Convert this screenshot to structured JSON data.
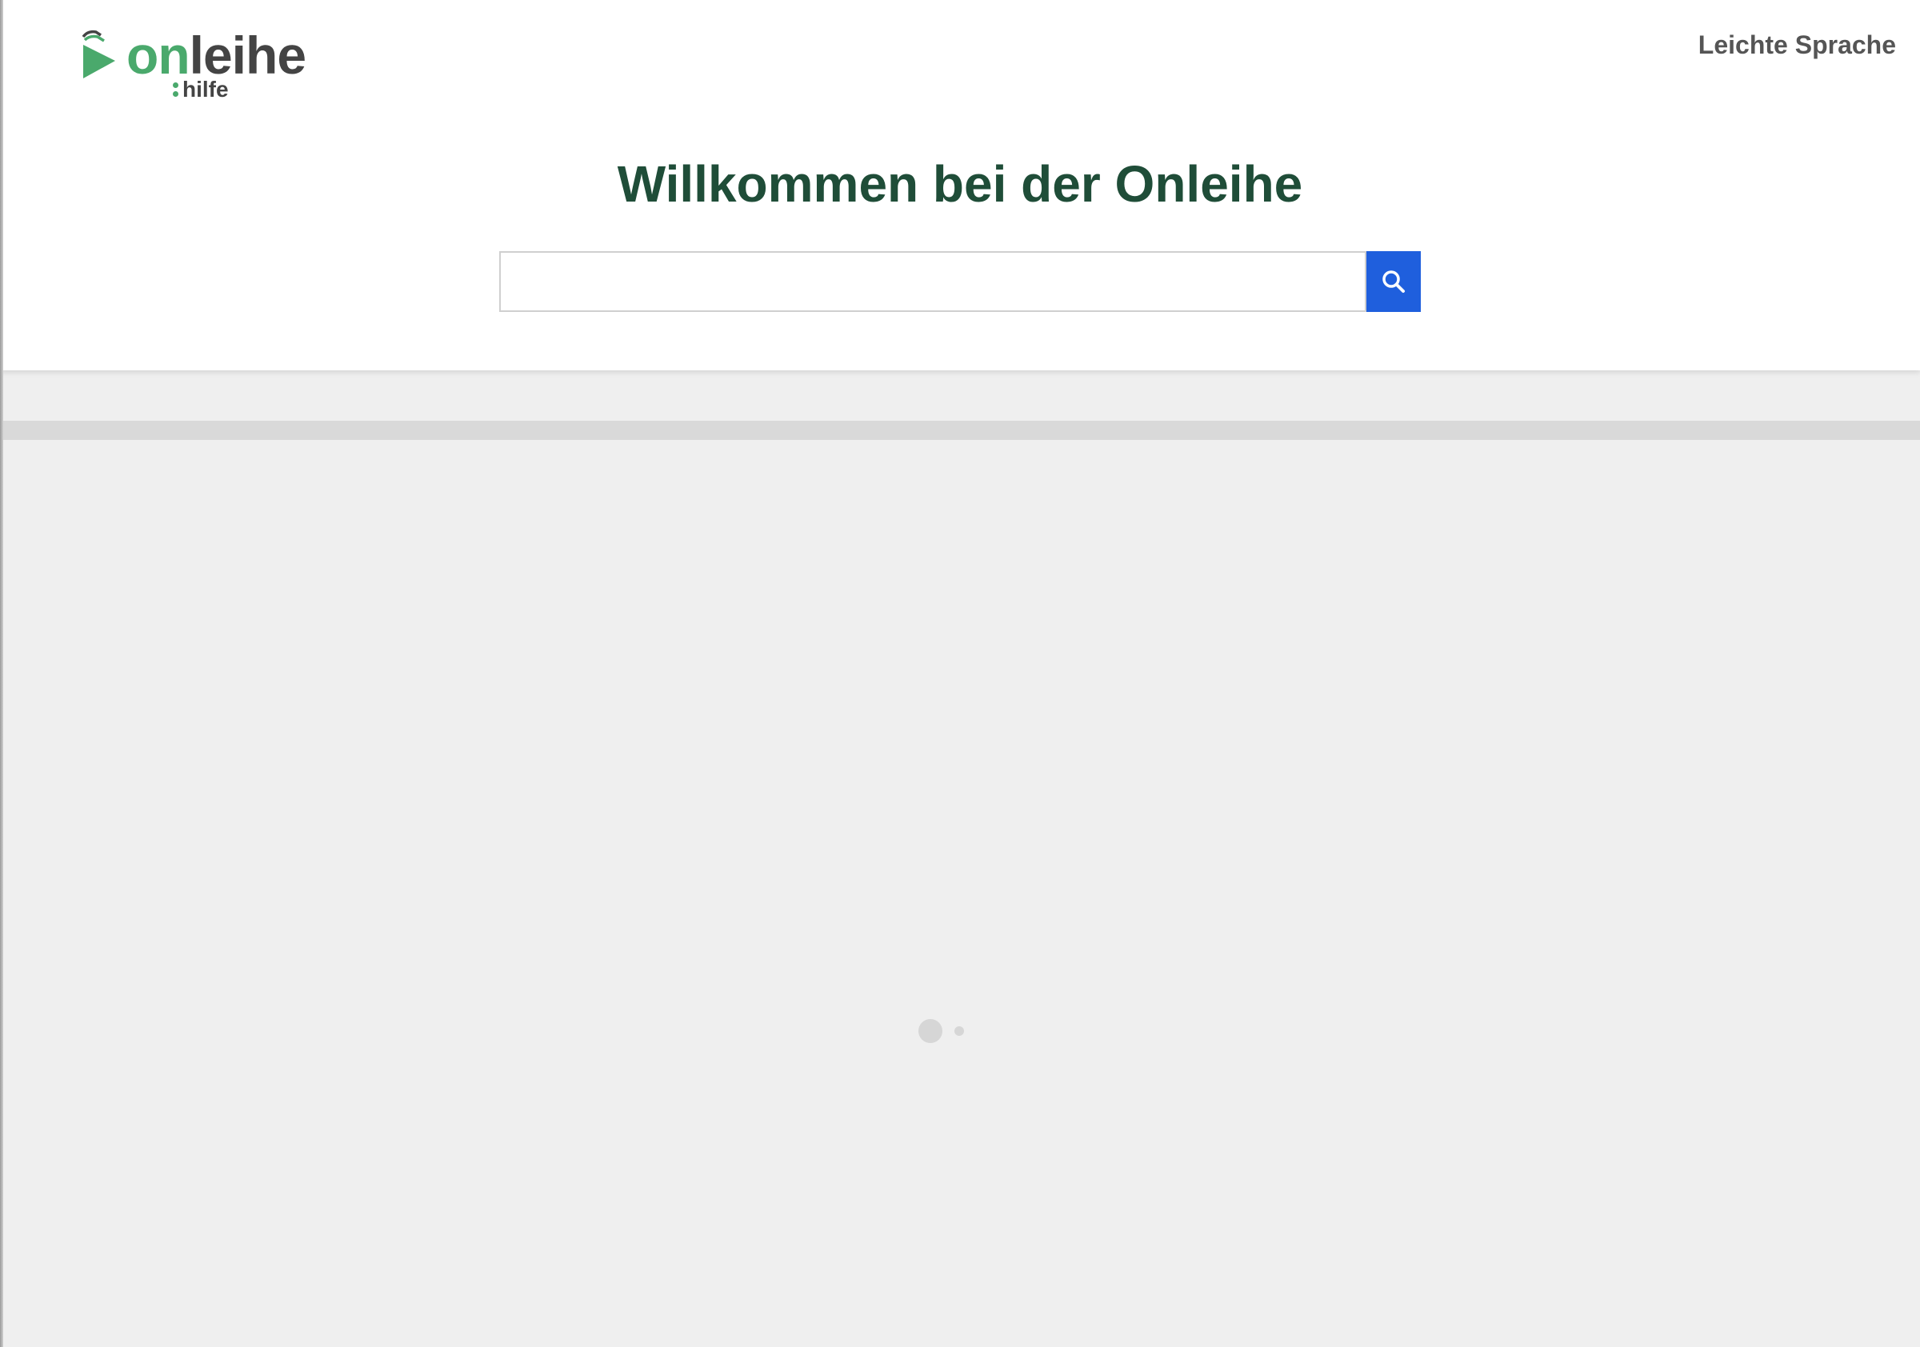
{
  "brand": {
    "name_accent": "on",
    "name_rest": "leihe",
    "sub": "hilfe",
    "accent_color": "#4aa96c",
    "text_color": "#444444"
  },
  "header": {
    "easy_language_link": "Leichte Sprache"
  },
  "main": {
    "title": "Willkommen bei der Onleihe",
    "title_color": "#1f4d38"
  },
  "search": {
    "value": "",
    "placeholder": "",
    "button_icon": "search-icon",
    "button_color": "#1f5fdd"
  },
  "content": {
    "state": "loading",
    "loader_icon": "loading-dots-icon"
  }
}
